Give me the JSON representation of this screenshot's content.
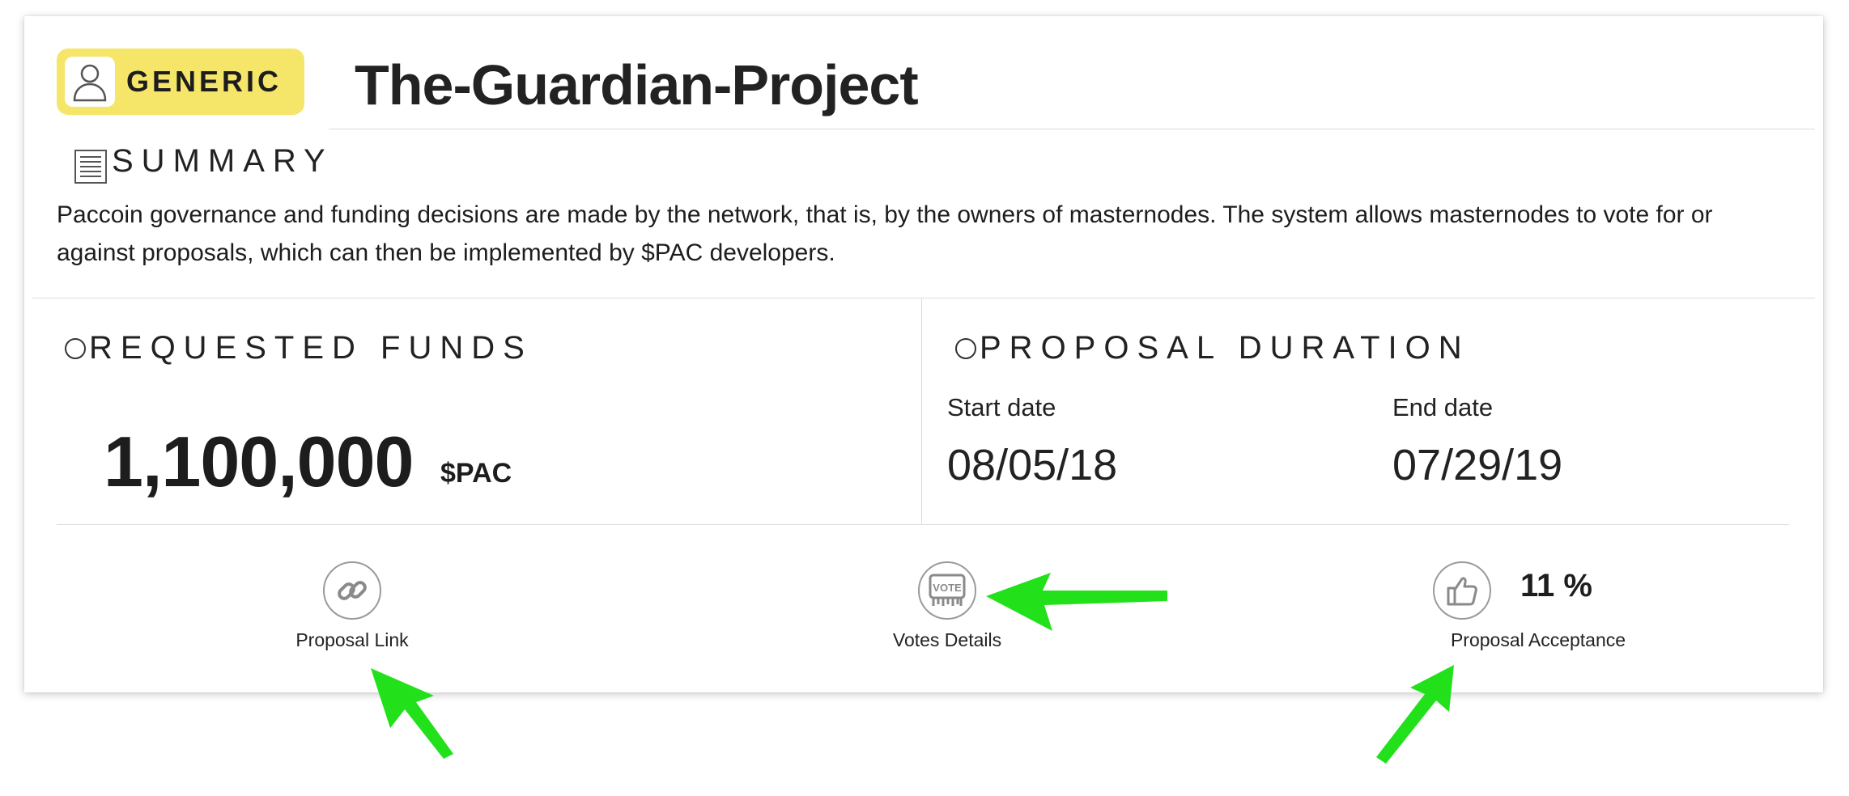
{
  "header": {
    "badge_label": "GENERIC",
    "title": "The-Guardian-Project"
  },
  "summary": {
    "heading": "SUMMARY",
    "text": "Paccoin governance and funding decisions are made by the network, that is, by the owners of masternodes. The system allows masternodes to vote for or against proposals, which can then be implemented by $PAC developers."
  },
  "funds": {
    "heading": "REQUESTED FUNDS",
    "amount": "1,100,000",
    "unit": "$PAC"
  },
  "duration": {
    "heading": "PROPOSAL DURATION",
    "start_label": "Start date",
    "start_value": "08/05/18",
    "end_label": "End date",
    "end_value": "07/29/19"
  },
  "actions": {
    "proposal_link_label": "Proposal Link",
    "votes_details_label": "Votes Details",
    "acceptance_label": "Proposal Acceptance",
    "acceptance_value": "11 %"
  },
  "icons": {
    "badge": "user-icon",
    "summary": "document-icon",
    "link": "link-icon",
    "vote": "vote-icon",
    "thumbs": "thumbs-up-icon"
  },
  "colors": {
    "badge_bg": "#f5e66a",
    "annotation_arrow": "#22e01a"
  }
}
